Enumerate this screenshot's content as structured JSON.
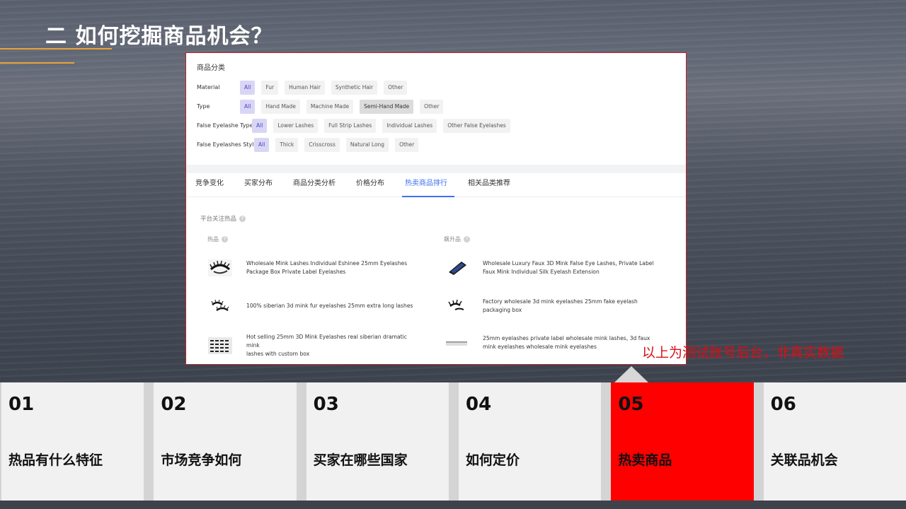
{
  "slide": {
    "title": "二 如何挖掘商品机会？",
    "note": "以上为测试账号后台，非真实数据"
  },
  "filters": {
    "heading": "商品分类",
    "rows": [
      {
        "label": "Material",
        "options": [
          "All",
          "Fur",
          "Human Hair",
          "Synthetic Hair",
          "Other"
        ]
      },
      {
        "label": "Type",
        "options": [
          "All",
          "Hand Made",
          "Machine Made",
          "Semi-Hand Made",
          "Other"
        ]
      },
      {
        "label": "False Eyelashe Type",
        "options": [
          "All",
          "Lower Lashes",
          "Full Strip Lashes",
          "Individual Lashes",
          "Other False Eyelashes"
        ]
      },
      {
        "label": "False Eyelashes Style",
        "options": [
          "All",
          "Thick",
          "Crisscross",
          "Natural Long",
          "Other"
        ]
      }
    ]
  },
  "tabs": [
    "竞争变化",
    "买家分布",
    "商品分类分析",
    "价格分布",
    "热卖商品排行",
    "相关品类推荐"
  ],
  "selected_tab": "热卖商品排行",
  "hot_products": {
    "section_title": "平台关注热品",
    "left_title": "热品",
    "right_title": "飙升品",
    "left_items": [
      {
        "line1": "Wholesale Mink Lashes Individual Eshinee 25mm Eyelashes",
        "line2": "Package Box Private Label Eyelashes"
      },
      {
        "line1": "100% siberian 3d mink fur eyelashes 25mm extra long lashes",
        "line2": ""
      },
      {
        "line1": "Hot selling 25mm 3D Mink Eyelashes real siberian dramatic mink",
        "line2": "lashes with custom box"
      }
    ],
    "right_items": [
      {
        "line1": "Wholesale Luxury Faux 3D Mink False Eye Lashes, Private Label",
        "line2": "Faux Mink Individual Silk Eyelash Extension"
      },
      {
        "line1": "Factory wholesale 3d mink eyelashes 25mm fake eyelash",
        "line2": "packaging box"
      },
      {
        "line1": "25mm eyelashes private label wholesale mink lashes, 3d faux",
        "line2": "mink eyelashes wholesale mink eyelashes"
      }
    ]
  },
  "nav": [
    {
      "num": "01",
      "label": "热品有什么特征"
    },
    {
      "num": "02",
      "label": "市场竞争如何"
    },
    {
      "num": "03",
      "label": "买家在哪些国家"
    },
    {
      "num": "04",
      "label": "如何定价"
    },
    {
      "num": "05",
      "label": "热卖商品"
    },
    {
      "num": "06",
      "label": "关联品机会"
    }
  ],
  "colors": {
    "accent_red": "#fe0000",
    "tab_blue": "#3d6ff0",
    "orange_line": "#e8a33a"
  }
}
